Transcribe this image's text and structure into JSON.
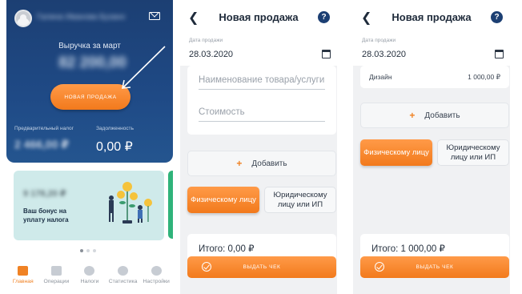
{
  "screen1": {
    "user_name": "Галина Иванова Бузановна",
    "revenue_label": "Выручка за март",
    "revenue_value": "82 200,00",
    "new_sale_button": "НОВАЯ ПРОДАЖА",
    "tax_label": "Предварительный налог",
    "tax_value": "2 466,00 ₽",
    "debt_label": "Задолженность",
    "debt_value": "0,00 ₽",
    "bonus": {
      "amount": "9 178,20 ₽",
      "text": "Ваш бонус на уплату налога"
    },
    "nav": [
      {
        "label": "Главная",
        "icon": "wallet-icon"
      },
      {
        "label": "Операции",
        "icon": "card-icon"
      },
      {
        "label": "Налоги",
        "icon": "coins-icon"
      },
      {
        "label": "Статистика",
        "icon": "pie-chart-icon"
      },
      {
        "label": "Настройки",
        "icon": "gear-icon"
      }
    ],
    "colors": {
      "primary": "#1f4a86",
      "accent": "#f08224"
    }
  },
  "screen2": {
    "title": "Новая продажа",
    "date_label": "Дата продажи",
    "date_value": "28.03.2020",
    "item_name_placeholder": "Наименование товара/услуги",
    "price_placeholder": "Стоимость",
    "add_button": "Добавить",
    "type_individual": "Физическому лицу",
    "type_legal": "Юридическому лицу или ИП",
    "total": "Итого: 0,00 ₽",
    "check_button": "ВЫДАТЬ ЧЕК"
  },
  "screen3": {
    "title": "Новая продажа",
    "date_label": "Дата продажи",
    "date_value": "28.03.2020",
    "item": {
      "name": "Дизайн",
      "price": "1 000,00 ₽"
    },
    "add_button": "Добавить",
    "type_individual": "Физическому лицу",
    "type_legal": "Юридическому лицу или ИП",
    "total": "Итого: 1 000,00 ₽",
    "check_button": "ВЫДАТЬ ЧЕК"
  }
}
